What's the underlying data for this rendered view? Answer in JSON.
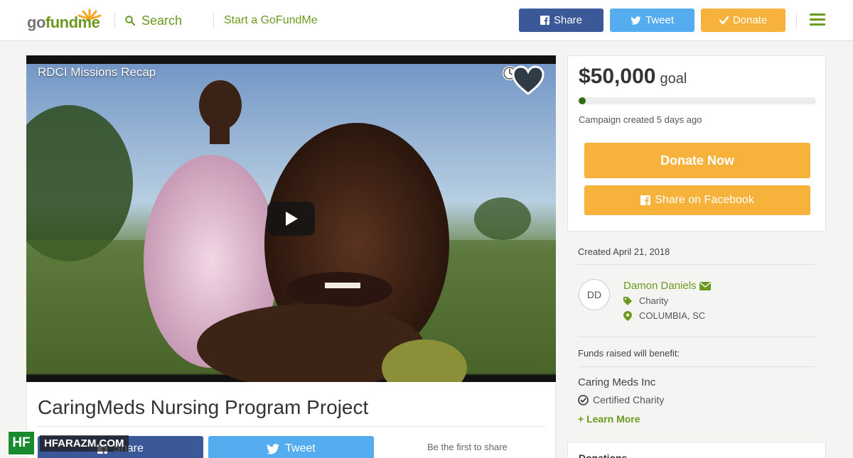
{
  "header": {
    "logo": "gofundme",
    "search_label": "Search",
    "start_label": "Start a GoFundMe",
    "share_label": "Share",
    "tweet_label": "Tweet",
    "donate_label": "Donate",
    "icons": [
      "logo",
      "search-icon",
      "facebook-icon",
      "twitter-icon",
      "check-icon",
      "menu-icon"
    ]
  },
  "video": {
    "title": "RDCI Missions Recap",
    "icons": [
      "clock-icon",
      "heart-icon",
      "play-icon"
    ]
  },
  "campaign": {
    "title": "CaringMeds Nursing Program Project",
    "share_label": "Share",
    "tweet_label": "Tweet",
    "first_share": "Be the first to share"
  },
  "sidebar": {
    "goal_amount": "$50,000",
    "goal_word": "goal",
    "progress_fraction": 0.03,
    "created_ago": "Campaign created 5 days ago",
    "donate_now": "Donate Now",
    "share_facebook": "Share on Facebook",
    "created_date": "Created April 21, 2018",
    "avatar_initials": "DD",
    "organizer": "Damon Daniels",
    "category": "Charity",
    "location": "COLUMBIA, SC",
    "benefit_label": "Funds raised will benefit:",
    "beneficiary": "Caring Meds Inc",
    "certified": "Certified Charity",
    "learn_more": "+ Learn More",
    "donations": "Donations"
  },
  "watermark": {
    "badge": "HF",
    "text": "HFARAZM.COM"
  },
  "colors": {
    "brand_green": "#6b9a1f",
    "facebook": "#3b5998",
    "twitter": "#55acee",
    "donate_orange": "#f6b23b"
  }
}
